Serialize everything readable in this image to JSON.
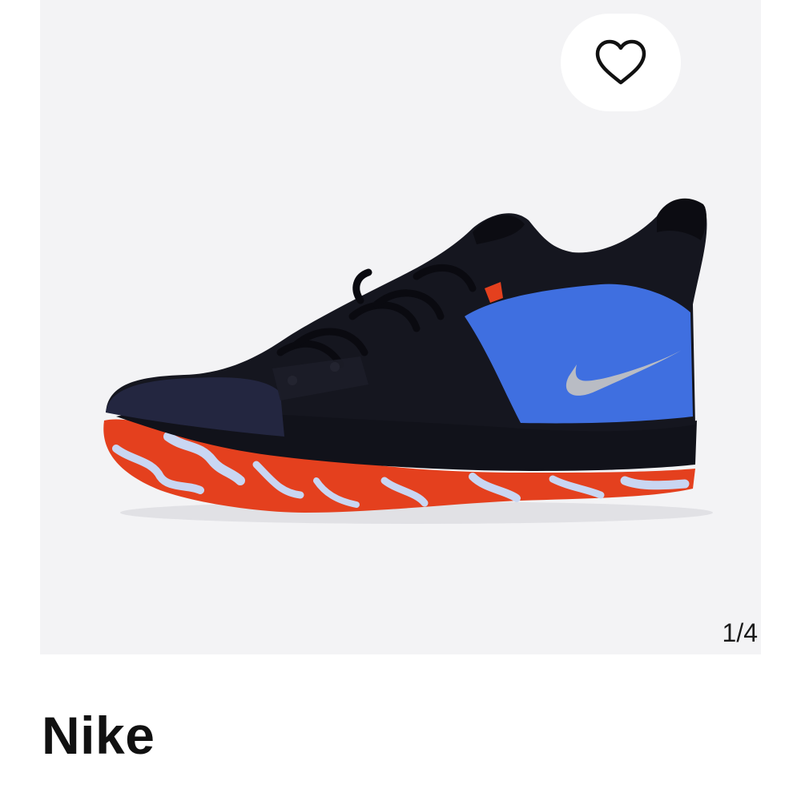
{
  "gallery": {
    "counter": "1/4",
    "favorite_icon": "heart-outline-icon",
    "image_subject": "sneaker"
  },
  "product": {
    "brand": "Nike"
  },
  "colors": {
    "gallery_background": "#f3f3f5",
    "shoe_upper": "#15161f",
    "shoe_panel": "#3f6fe0",
    "sole_red": "#e4401e",
    "sole_marble": "#c9d6f2"
  }
}
